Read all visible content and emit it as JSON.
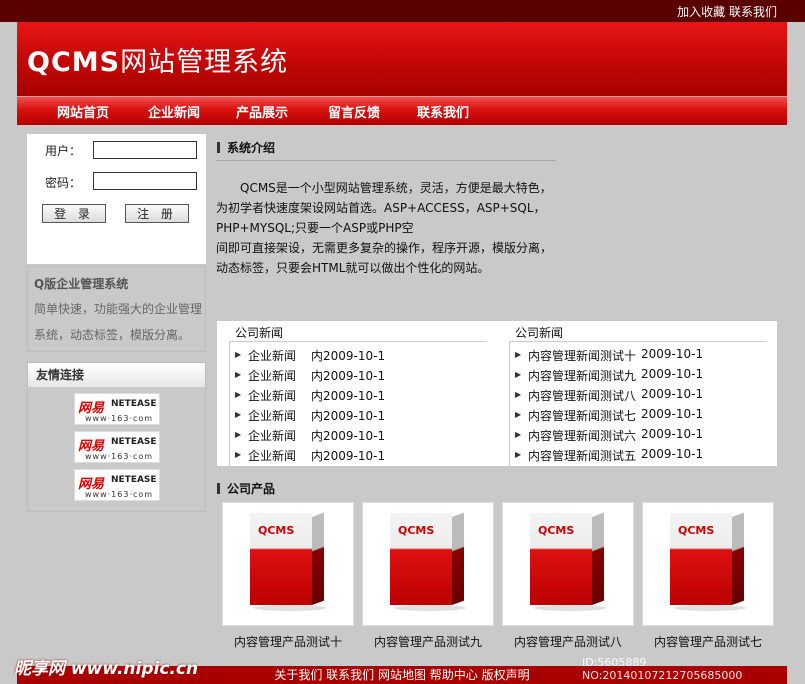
{
  "topbar": {
    "links": "加入收藏 联系我们"
  },
  "banner": {
    "title_latin": "QCMS",
    "title_cn": "网站管理系统"
  },
  "nav": [
    "网站首页",
    "企业新闻",
    "产品展示",
    "留言反馈",
    "联系我们"
  ],
  "login": {
    "user_label": "用户：",
    "pass_label": "密码：",
    "login_btn": "登 录",
    "register_btn": "注 册"
  },
  "about": {
    "heading": "Q版企业管理系统",
    "text": "简单快速，功能强大的企业管理系统，动态标签，模版分离。"
  },
  "friend_links": {
    "heading": "友情连接",
    "logo_text": "网易",
    "logo_en": "NETEASE",
    "logo_url": "www·163·com"
  },
  "intro": {
    "heading": "系统介绍",
    "lines": [
      "QCMS是一个小型网站管理系统，灵活，方便是最大特色，",
      "为初学者快速度架设网站首选。ASP+ACCESS，ASP+SQL，",
      "PHP+MYSQL;只要一个ASP或PHP空",
      "间即可直接架设，无需更多复杂的操作，程序开源，模版分离，",
      "动态标签，只要会HTML就可以做出个性化的网站。"
    ]
  },
  "news": {
    "left": {
      "heading": "公司新闻",
      "items": [
        {
          "title": "企业新闻",
          "date": "内2009-10-1"
        },
        {
          "title": "企业新闻",
          "date": "内2009-10-1"
        },
        {
          "title": "企业新闻",
          "date": "内2009-10-1"
        },
        {
          "title": "企业新闻",
          "date": "内2009-10-1"
        },
        {
          "title": "企业新闻",
          "date": "内2009-10-1"
        },
        {
          "title": "企业新闻",
          "date": "内2009-10-1"
        }
      ]
    },
    "right": {
      "heading": "公司新闻",
      "items": [
        {
          "title": "内容管理新闻测试十",
          "date": "2009-10-1"
        },
        {
          "title": "内容管理新闻测试九",
          "date": "2009-10-1"
        },
        {
          "title": "内容管理新闻测试八",
          "date": "2009-10-1"
        },
        {
          "title": "内容管理新闻测试七",
          "date": "2009-10-1"
        },
        {
          "title": "内容管理新闻测试六",
          "date": "2009-10-1"
        },
        {
          "title": "内容管理新闻测试五",
          "date": "2009-10-1"
        }
      ]
    }
  },
  "products": {
    "heading": "公司产品",
    "box_label": "QCMS",
    "items": [
      "内容管理产品测试十",
      "内容管理产品测试九",
      "内容管理产品测试八",
      "内容管理产品测试七"
    ]
  },
  "footer": {
    "links": "关于我们 联系我们 网站地图 帮助中心 版权声明"
  },
  "watermark": {
    "site": "昵享网 www.nipic.cn",
    "id": "ID:5605889 NO:20140107212705685000"
  }
}
